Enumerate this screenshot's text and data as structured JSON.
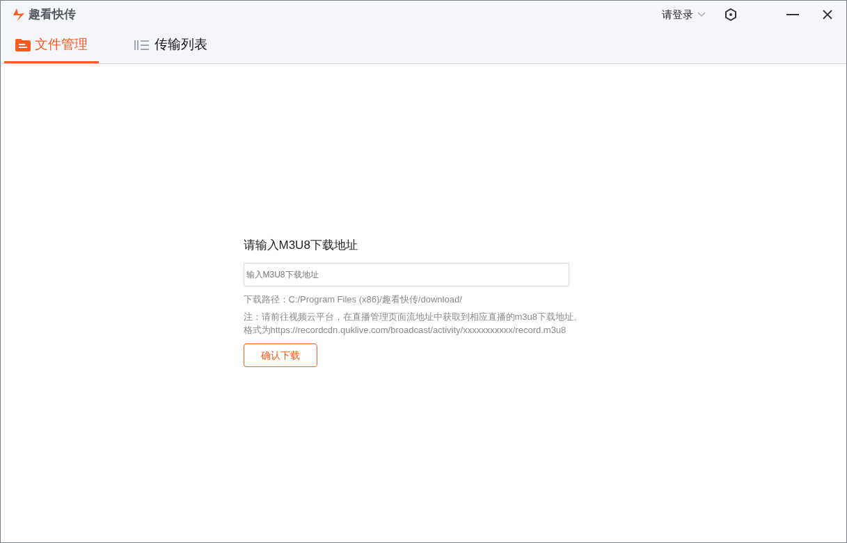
{
  "window": {
    "title": "趣看快传"
  },
  "account": {
    "label": "请登录"
  },
  "tabs": [
    {
      "label": "文件管理",
      "selected": true,
      "kind": "folder"
    },
    {
      "label": "传输列表",
      "selected": false,
      "kind": "list"
    }
  ],
  "form": {
    "heading": "请输入M3U8下载地址",
    "input": {
      "placeholder": "输入M3U8下载地址"
    },
    "path": "下载路径：C:/Program Files (x86)/趣看快传/download/",
    "note": "注：请前往视频云平台，在直播管理页面流地址中获取到相应直播的m3u8下载地址。格式为https://recordcdn.quklive.com/broadcast/activity/xxxxxxxxxxx/record.m3u8",
    "button": "确认下载"
  }
}
